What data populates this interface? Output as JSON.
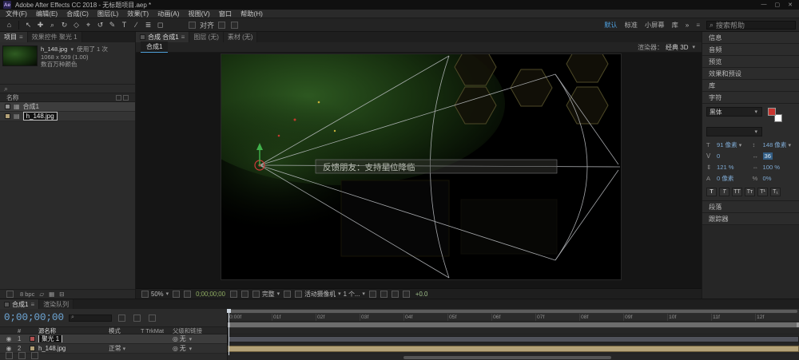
{
  "titlebar": {
    "title": "Adobe After Effects CC 2018 - 无标题项目.aep *"
  },
  "menubar": {
    "items": [
      "文件(F)",
      "编辑(E)",
      "合成(C)",
      "图层(L)",
      "效果(T)",
      "动画(A)",
      "视图(V)",
      "窗口",
      "帮助(H)"
    ]
  },
  "toolbar": {
    "tools": [
      "⌂",
      "↖",
      "✚",
      "⌕",
      "↻",
      "◇",
      "⌖",
      "↺",
      "✎",
      "T",
      "∕",
      "≣",
      "◻"
    ],
    "align_label": "对齐",
    "workspaces": [
      "默认",
      "标准",
      "小屏幕",
      "库"
    ],
    "overflow": "»",
    "search_placeholder": "搜索帮助"
  },
  "project": {
    "tabs": [
      {
        "label": "项目"
      },
      {
        "label": "效果控件 聚光 1"
      }
    ],
    "preview": {
      "name": "h_148.jpg",
      "usage": "使用了 1 次",
      "dimensions": "1068 x 509 (1.00)",
      "color_depth": "数百万种颜色"
    },
    "columns": {
      "name": "名称"
    },
    "items": [
      {
        "name": "合成1"
      },
      {
        "name": "h_148.jpg"
      }
    ],
    "footer": {
      "bpc": "8 bpc"
    }
  },
  "viewer": {
    "tabs": [
      {
        "label": "合成 合成1"
      },
      {
        "label": "图层 (无)"
      },
      {
        "label": "素材 (无)"
      }
    ],
    "comp_tab": "合成1",
    "renderer": {
      "label": "渲染器：",
      "value": "经典 3D"
    },
    "overlay_text": "反馈朋友：支持星位降临",
    "controls": {
      "zoom": "50%",
      "timecode": "0;00;00;00",
      "resolution": "完整",
      "view": "活动摄像机",
      "view_count": "1 个...",
      "exposure": "+0.0"
    }
  },
  "sidebar": {
    "panels": [
      "信息",
      "音频",
      "预览",
      "效果和预设",
      "库"
    ],
    "character": {
      "title": "字符",
      "font_family": "黑体",
      "font_style": "",
      "font_size": "91 像素",
      "leading": "148 像素",
      "kerning": "0",
      "tracking": "36",
      "vertical_scale": "121 %",
      "horizontal_scale": "100 %",
      "baseline_shift": "0 像素",
      "proportional_spacing": "0%",
      "style_buttons": [
        "T",
        "T",
        "TT",
        "Tᴛ",
        "T¹",
        "T₁"
      ]
    },
    "bottom_panels": [
      "段落",
      "跟踪器"
    ]
  },
  "timeline": {
    "tabs": [
      {
        "label": "合成1"
      },
      {
        "label": "渲染队列"
      }
    ],
    "timecode": "0;00;00;00",
    "columns": [
      "源名称",
      "模式",
      "T TrkMat",
      "父级和链接"
    ],
    "layers": [
      {
        "index": "1",
        "name": "聚光 1",
        "mode": "",
        "parent": "无"
      },
      {
        "index": "2",
        "name": "h_148.jpg",
        "mode": "正常",
        "parent": "无"
      }
    ],
    "ruler": [
      "0:00f",
      "01f",
      "02f",
      "03f",
      "04f",
      "05f",
      "06f",
      "07f",
      "08f",
      "09f",
      "10f",
      "11f",
      "12f"
    ]
  },
  "icons": {
    "app": "Ae",
    "minimize": "—",
    "maximize": "▢",
    "close": "✕",
    "caret": "▾",
    "grip": "≡",
    "search": "⌕",
    "eye": "◉",
    "pickwhip": "◎",
    "comp": "▦",
    "footage": "▤",
    "light": "◆",
    "folder": "▱",
    "newcomp": "▦",
    "trash": "⊟",
    "t_size": "T",
    "t_leading": "↕",
    "t_kern": "Ⅴ",
    "t_track": "↔",
    "t_vscale": "⇕",
    "t_hscale": "⇔",
    "t_baseline": "A",
    "t_tsume": "%"
  },
  "colors": {
    "accent": "#4fa3e3",
    "footage_bar": "#b3a177",
    "timecode_blue": "#6fa8d8",
    "viewer_timecode_green": "#8fae62"
  }
}
